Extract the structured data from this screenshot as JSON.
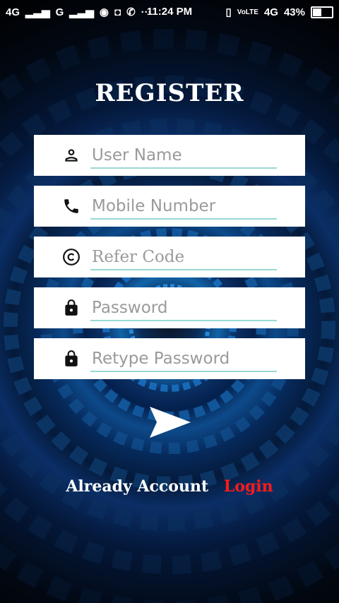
{
  "status_bar": {
    "left_signals": "4G",
    "left_signals_2": "G",
    "time": "11:24 PM",
    "right_network": "4G",
    "battery": "43%",
    "battery_level": 0.43
  },
  "title": "REGISTER",
  "fields": [
    {
      "placeholder": "User Name",
      "icon": "person-icon"
    },
    {
      "placeholder": "Mobile Number",
      "icon": "phone-icon"
    },
    {
      "placeholder": "Refer Code",
      "icon": "copyright-icon"
    },
    {
      "placeholder": "Password",
      "icon": "lock-icon"
    },
    {
      "placeholder": "Retype Password",
      "icon": "lock-icon"
    }
  ],
  "footer": {
    "already_label": "Already Account",
    "login_label": "Login"
  },
  "colors": {
    "accent_underline": "#9ad8d4",
    "login": "#ff1a1a"
  }
}
